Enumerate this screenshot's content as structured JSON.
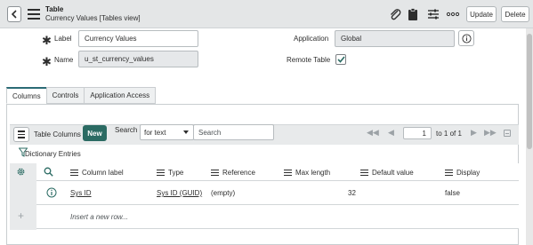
{
  "header": {
    "title": "Table",
    "subtitle": "Currency Values [Tables view]",
    "update_label": "Update",
    "delete_label": "Delete"
  },
  "form": {
    "label_field": {
      "label": "Label",
      "value": "Currency Values"
    },
    "name_field": {
      "label": "Name",
      "value": "u_st_currency_values"
    },
    "application_field": {
      "label": "Application",
      "value": "Global"
    },
    "remote_table_field": {
      "label": "Remote Table",
      "checked": true
    }
  },
  "tabs": [
    {
      "label": "Columns",
      "active": true
    },
    {
      "label": "Controls",
      "active": false
    },
    {
      "label": "Application Access",
      "active": false
    }
  ],
  "list": {
    "title": "Table Columns",
    "new_label": "New",
    "search_label": "Search",
    "search_field": "for text",
    "search_placeholder": "Search",
    "page_value": "1",
    "page_range": "to 1 of 1",
    "filter_label": "Dictionary Entries",
    "columns": [
      "Column label",
      "Type",
      "Reference",
      "Max length",
      "Default value",
      "Display"
    ],
    "rows": [
      {
        "column_label": "Sys ID",
        "type": "Sys ID (GUID)",
        "reference": "(empty)",
        "max_length": "32",
        "default_value": "",
        "display": "false"
      }
    ],
    "insert_row_label": "Insert a new row..."
  },
  "colors": {
    "accent": "#2b6b63",
    "background": "#e4e6e7"
  }
}
